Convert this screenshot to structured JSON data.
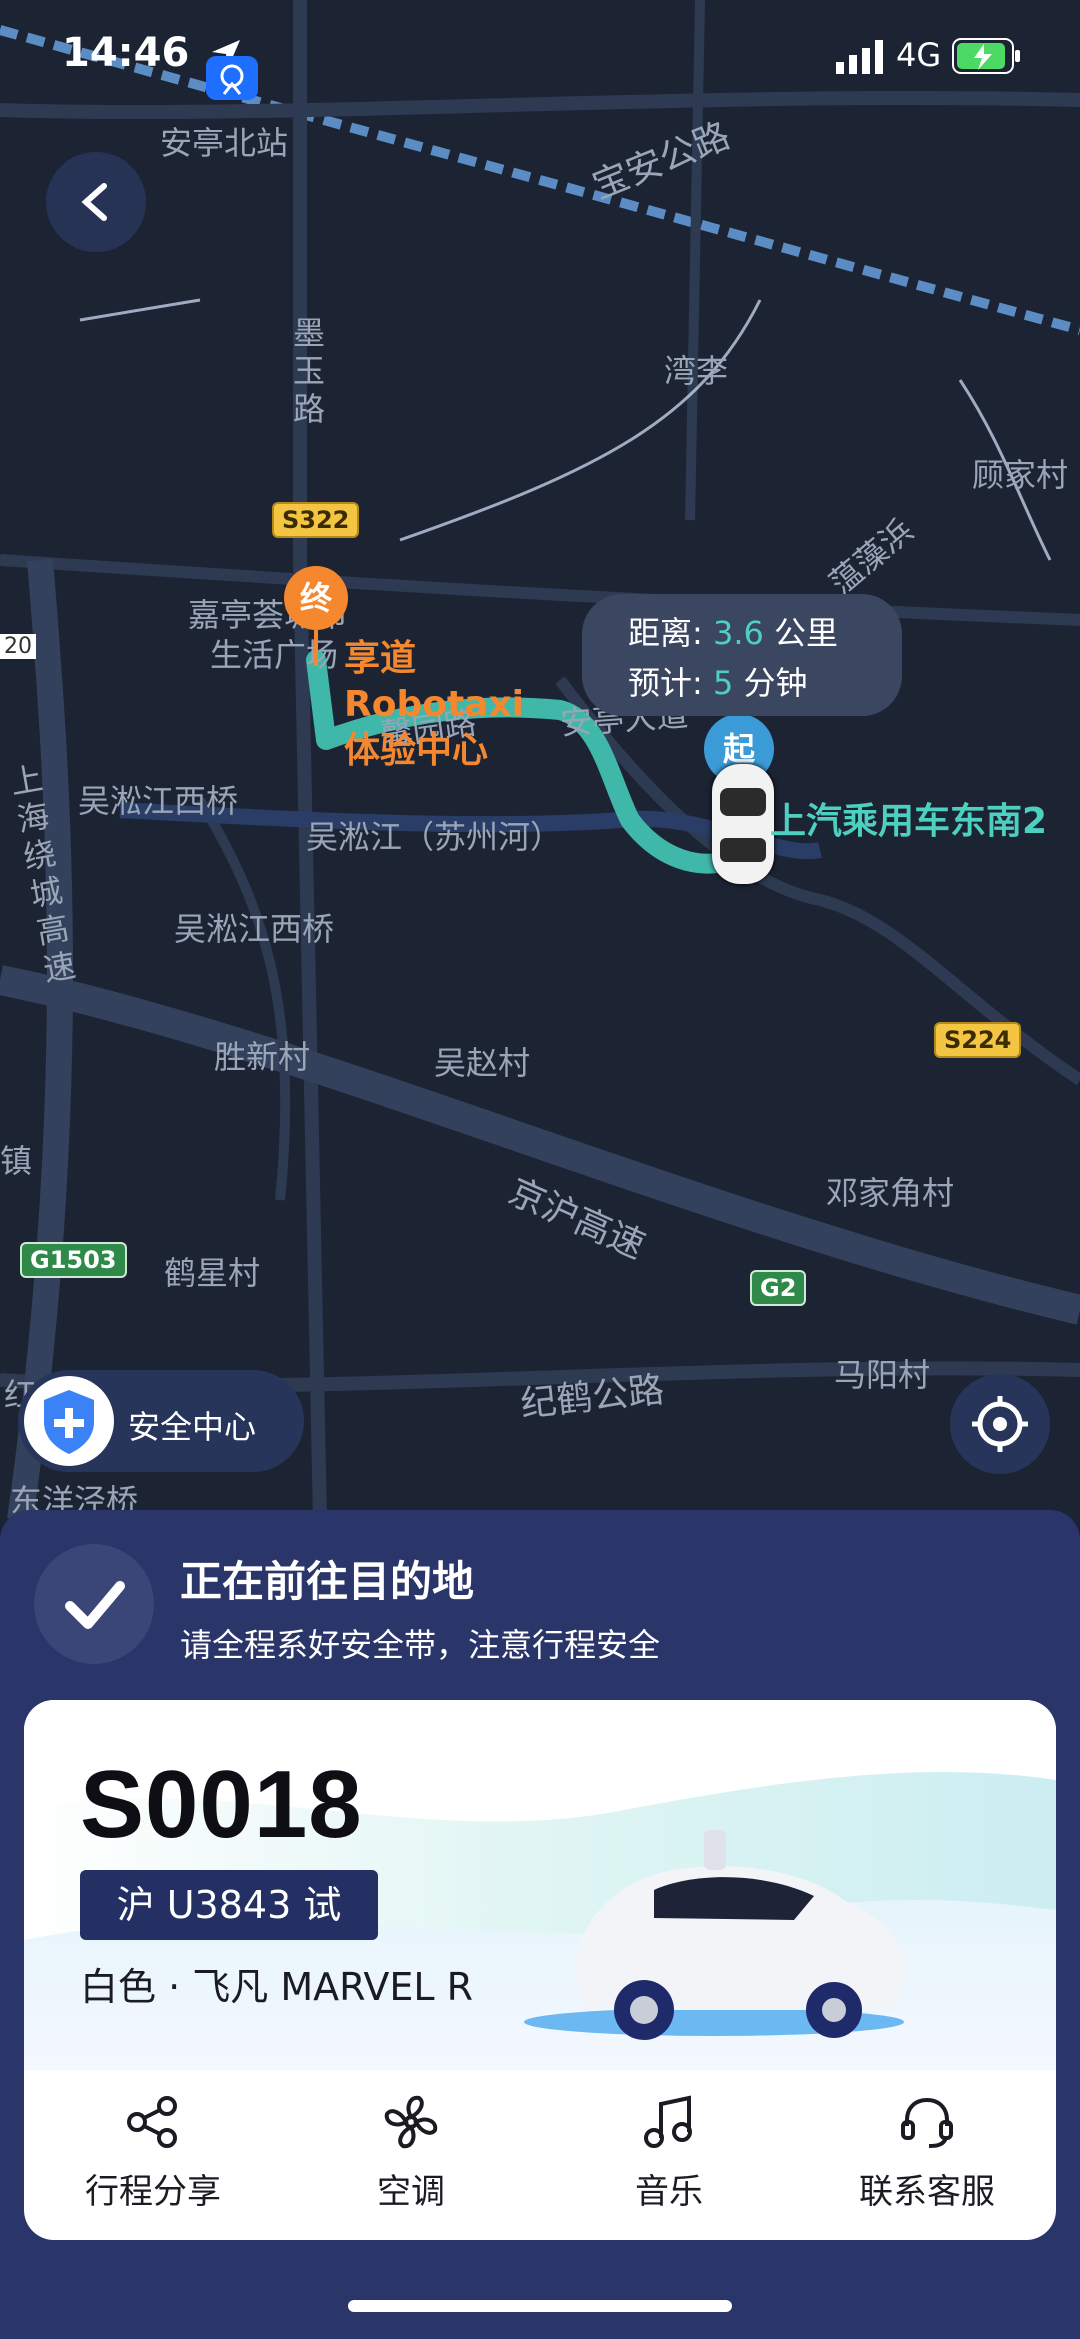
{
  "status_bar": {
    "time": "14:46",
    "network": "4G"
  },
  "map": {
    "labels": {
      "anting_north": "安亭北站",
      "baoan_road": "宝安公路",
      "wanli": "湾李",
      "gujiacun": "顾家村",
      "jiating_market": "嘉亭荟城市",
      "shenghuo": "生活广场",
      "wusong_west_1": "吴淞江西桥",
      "wusong_river": "吴淞江（苏州河）",
      "wusong_west_2": "吴淞江西桥",
      "shengxin": "胜新村",
      "wuzhao": "吴赵村",
      "dengjiajiao": "邓家角村",
      "town": "镇",
      "hexing": "鹤星村",
      "mayang": "马阳村",
      "jihe_road": "纪鹤公路",
      "jinghu": "京沪高速",
      "xinyuan": "馨园路",
      "anting_hub": "安亭大道",
      "wenzao": "蕰藻浜",
      "moyu_road": "墨玉路",
      "ring_highway": "上海绕城高速",
      "yangjing": "东洋泾桥",
      "edge_20": "20",
      "edge_hong": "红"
    },
    "shields": {
      "s322": "S322",
      "s224": "S224",
      "g1503": "G1503",
      "g2": "G2"
    },
    "route_color": "#3fb7a9",
    "end_marker": "终",
    "start_marker": "起",
    "destination_label": "享道 Robotaxi 体验中心",
    "start_label": "上汽乘用车东南2",
    "eta": {
      "distance_label": "距离:",
      "distance_value": "3.6",
      "distance_unit": "公里",
      "time_label": "预计:",
      "time_value": "5",
      "time_unit": "分钟"
    }
  },
  "safety_center": {
    "label": "安全中心",
    "icon": "shield-plus-icon"
  },
  "trip_status": {
    "title": "正在前往目的地",
    "subtitle": "请全程系好安全带，注意行程安全"
  },
  "vehicle": {
    "id": "S0018",
    "plate": "沪 U3843 试",
    "description": "白色 · 飞凡 MARVEL R"
  },
  "actions": [
    {
      "label": "行程分享",
      "icon": "share-icon"
    },
    {
      "label": "空调",
      "icon": "fan-icon"
    },
    {
      "label": "音乐",
      "icon": "music-icon"
    },
    {
      "label": "联系客服",
      "icon": "headset-icon"
    }
  ],
  "colors": {
    "accent": "#4ed0c1",
    "destination": "#f5872e",
    "panel": "#2a3569"
  }
}
